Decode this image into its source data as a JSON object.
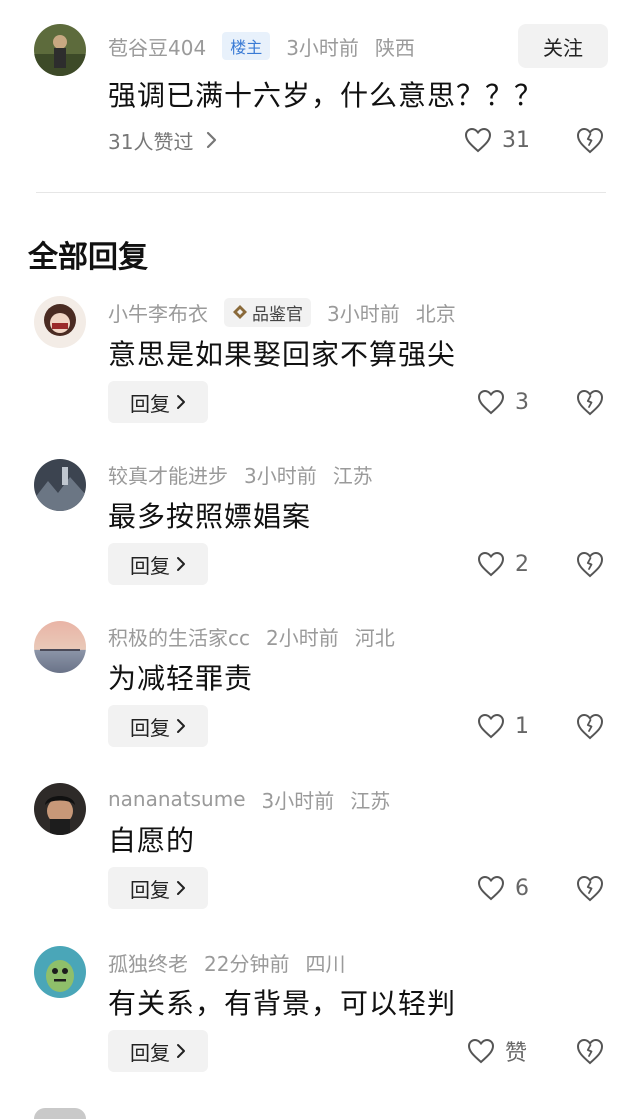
{
  "main_comment": {
    "username": "苞谷豆404",
    "owner_badge": "楼主",
    "time": "3小时前",
    "location": "陕西",
    "follow_label": "关注",
    "text": "强调已满十六岁，什么意思？？？",
    "likers_label": "31人赞过",
    "like_count": "31"
  },
  "section_title": "全部回复",
  "reply_button_label": "回复",
  "replies": [
    {
      "username": "小牛李布衣",
      "badge": "品鉴官",
      "time": "3小时前",
      "location": "北京",
      "text": "意思是如果娶回家不算强尖",
      "like_count": "3"
    },
    {
      "username": "较真才能进步",
      "time": "3小时前",
      "location": "江苏",
      "text": "最多按照嫖娼案",
      "like_count": "2"
    },
    {
      "username": "积极的生活家cc",
      "time": "2小时前",
      "location": "河北",
      "text": "为减轻罪责",
      "like_count": "1"
    },
    {
      "username": "nananatsume",
      "time": "3小时前",
      "location": "江苏",
      "text": "自愿的",
      "like_count": "6"
    },
    {
      "username": "孤独终老",
      "time": "22分钟前",
      "location": "四川",
      "text": "有关系，有背景，可以轻判",
      "like_count": "赞"
    }
  ],
  "icons": {
    "like": "heart-outline-icon",
    "dislike": "broken-heart-icon",
    "chevron": "chevron-right-icon",
    "judge_badge": "diamond-badge-icon"
  },
  "colors": {
    "owner_badge_bg": "#e8f1fb",
    "owner_badge_text": "#3a7bd5",
    "meta_text": "#9a9a9a",
    "button_bg": "#f2f2f2"
  }
}
